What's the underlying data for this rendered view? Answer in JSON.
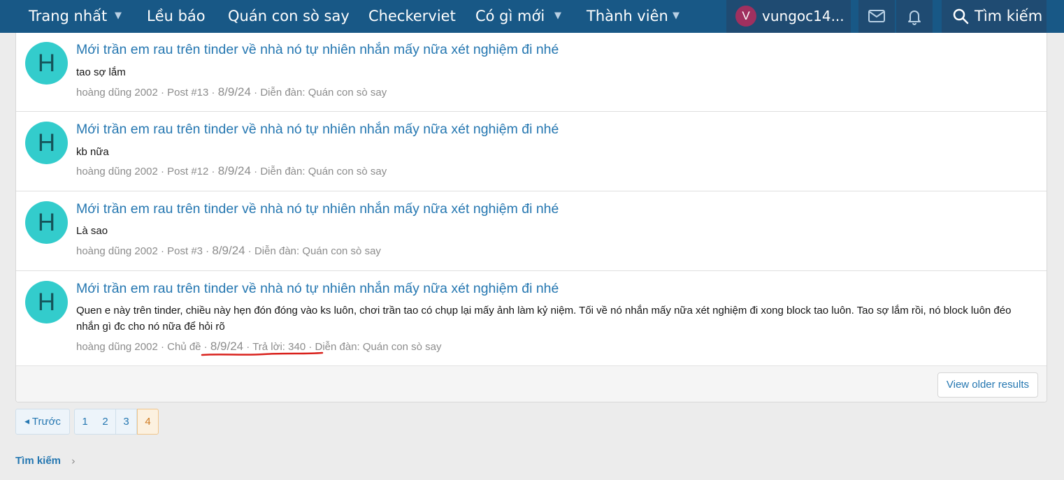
{
  "nav": {
    "items": [
      {
        "label": "Trang nhất",
        "has_menu": true
      },
      {
        "label": "Lều báo",
        "has_menu": false
      },
      {
        "label": "Quán con sò say",
        "has_menu": false
      },
      {
        "label": "Checkerviet",
        "has_menu": false
      },
      {
        "label": "Có gì mới",
        "has_menu": true
      },
      {
        "label": "Thành viên",
        "has_menu": true
      }
    ],
    "user": {
      "avatar_letter": "V",
      "name": "vungoc14...",
      "avatar_color": "#a0305f"
    },
    "search_label": "Tìm kiếm",
    "bar_color": "#185886"
  },
  "results": [
    {
      "avatar_letter": "H",
      "title": "Mới trần em rau trên tinder về nhà nó tự nhiên nhắn mấy nữa xét nghiệm đi nhé",
      "snippet": "tao sợ lắm",
      "author": "hoàng dũng 2002",
      "type": "Post #13",
      "date": "8/9/24",
      "forum": "Diễn đàn: Quán con sò say"
    },
    {
      "avatar_letter": "H",
      "title": "Mới trần em rau trên tinder về nhà nó tự nhiên nhắn mấy nữa xét nghiệm đi nhé",
      "snippet": "kb nữa",
      "author": "hoàng dũng 2002",
      "type": "Post #12",
      "date": "8/9/24",
      "forum": "Diễn đàn: Quán con sò say"
    },
    {
      "avatar_letter": "H",
      "title": "Mới trần em rau trên tinder về nhà nó tự nhiên nhắn mấy nữa xét nghiệm đi nhé",
      "snippet": "Là sao",
      "author": "hoàng dũng 2002",
      "type": "Post #3",
      "date": "8/9/24",
      "forum": "Diễn đàn: Quán con sò say"
    },
    {
      "avatar_letter": "H",
      "title": "Mới trần em rau trên tinder về nhà nó tự nhiên nhắn mấy nữa xét nghiệm đi nhé",
      "snippet": "Quen e này trên tinder, chiều này hẹn đón đóng vào ks luôn, chơi trần tao có chụp lại mấy ảnh làm kỷ niệm. Tối về nó nhắn mấy nữa xét nghiệm đi xong block tao luôn. Tao sợ lắm rồi, nó block luôn đéo nhắn gì đc cho nó nữa để hỏi rõ",
      "author": "hoàng dũng 2002",
      "type": "Chủ đề",
      "date": "8/9/24",
      "replies": "Trả lời: 340",
      "forum": "Diễn đàn: Quán con sò say"
    }
  ],
  "older_results_label": "View older results",
  "pagination": {
    "prev_label": "Trước",
    "pages": [
      "1",
      "2",
      "3",
      "4"
    ],
    "current": "4"
  },
  "breadcrumb": {
    "label": "Tìm kiếm"
  },
  "colors": {
    "link": "#2577b1",
    "avatar_h": "#33cccc",
    "annotation_underline": "#d9211c"
  }
}
